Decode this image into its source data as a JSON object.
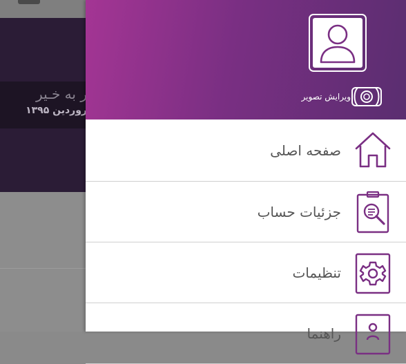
{
  "background": {
    "title": "ر به خـیر",
    "date": "روردین ۱۳۹۵"
  },
  "drawer": {
    "header": {
      "edit_photo_label": "ویرایش تصویر",
      "avatar_icon": "user-silhouette-icon",
      "camera_icon": "camera-icon"
    },
    "menu": [
      {
        "label": "صفحه اصلی",
        "icon": "home-icon"
      },
      {
        "label": "جزئیات حساب",
        "icon": "account-details-icon"
      },
      {
        "label": "تنظیمات",
        "icon": "settings-gear-icon"
      },
      {
        "label": "راهنما",
        "icon": "help-icon"
      }
    ]
  },
  "colors": {
    "accent": "#7a2f83",
    "header_gradient_start": "#a43594",
    "header_gradient_end": "#5a2e70",
    "menu_text": "#555555"
  }
}
